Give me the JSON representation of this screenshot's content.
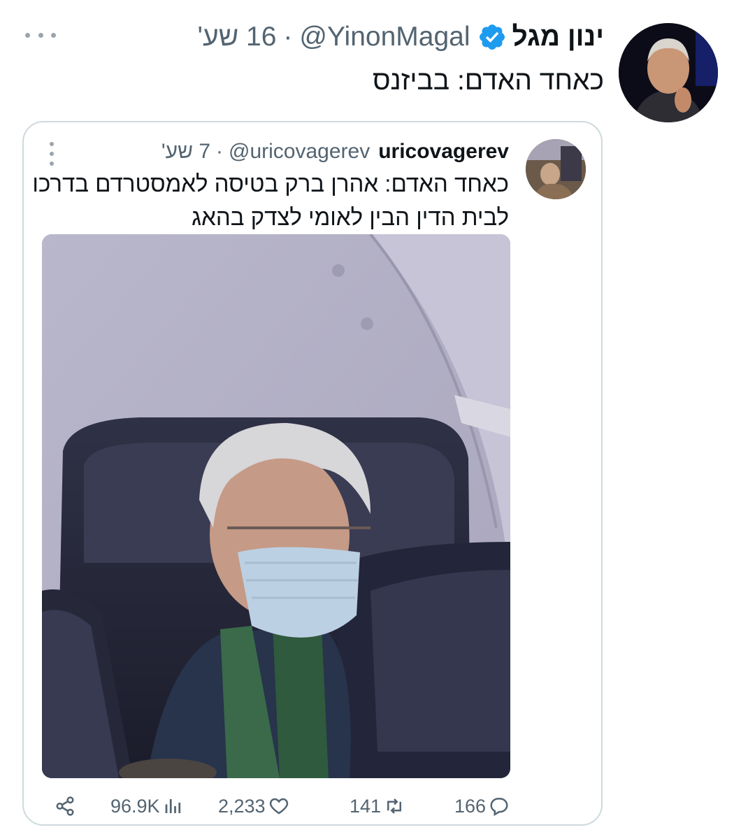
{
  "tweet": {
    "author_name": "ינון מגל",
    "handle": "@YinonMagal",
    "separator": "·",
    "time": "16 שע'",
    "text": "כאחד האדם: בביזנס",
    "verified": true,
    "icons": {
      "verified": "verified-badge-icon",
      "more": "more-horizontal-icon"
    }
  },
  "quoted": {
    "author_name": "uricovagerev",
    "handle": "@uricovagerev",
    "separator": "·",
    "time": "7 שע'",
    "text_lines": [
      "כאחד האדם: אהרן ברק בטיסה לאמסטרדם בדרכו",
      "לבית הדין הבין לאומי לצדק בהאג"
    ],
    "icons": {
      "more": "more-vertical-icon"
    }
  },
  "actions": {
    "share": {
      "icon": "share-icon"
    },
    "views": {
      "count": "96.9K",
      "icon": "views-chart-icon"
    },
    "likes": {
      "count": "2,233",
      "icon": "heart-icon"
    },
    "retweets": {
      "count": "141",
      "icon": "retweet-icon"
    },
    "replies": {
      "count": "166",
      "icon": "reply-icon"
    }
  },
  "colors": {
    "text": "#0f1419",
    "secondary": "#536471",
    "verified": "#1d9bf0",
    "border": "#cfd9de"
  }
}
